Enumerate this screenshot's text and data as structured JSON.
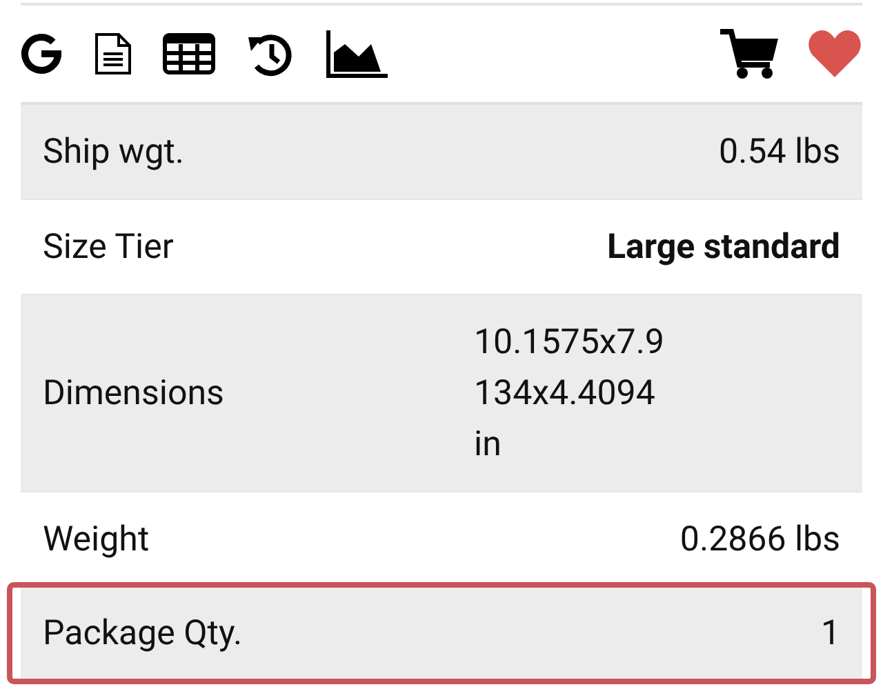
{
  "rows": [
    {
      "label": "Ship wgt.",
      "value": "0.54 lbs",
      "kind": "plain",
      "highlighted": false
    },
    {
      "label": "Size Tier",
      "value": "Large standard",
      "kind": "bold",
      "highlighted": false
    },
    {
      "label": "Dimensions",
      "value": "10.1575x7.9134x4.4094 in",
      "kind": "wrapped",
      "highlighted": false
    },
    {
      "label": "Weight",
      "value": "0.2866 lbs",
      "kind": "plain",
      "highlighted": false
    },
    {
      "label": "Package Qty.",
      "value": "1",
      "kind": "plain",
      "highlighted": true
    }
  ]
}
